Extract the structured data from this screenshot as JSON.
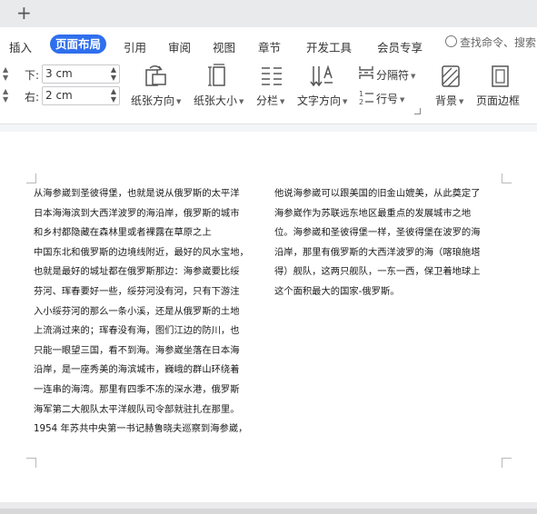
{
  "tabbar": {
    "new_tab": "+"
  },
  "menu": {
    "items": [
      "插入",
      "页面布局",
      "引用",
      "审阅",
      "视图",
      "章节",
      "开发工具",
      "会员专享"
    ],
    "active": "页面布局",
    "search_placeholder": "查找命令、搜索"
  },
  "ribbon": {
    "margin_bottom_label": "下:",
    "margin_bottom_value": "3 cm",
    "margin_right_label": "右:",
    "margin_right_value": "2 cm",
    "orientation": "纸张方向",
    "size": "纸张大小",
    "columns": "分栏",
    "text_direction": "文字方向",
    "breaks": "分隔符",
    "line_numbers": "行号",
    "background": "背景",
    "page_border": "页面边框"
  },
  "document": {
    "left_column": [
      "从海参崴到圣彼得堡，也就是说从俄罗斯的太平洋",
      "日本海海滨到大西洋波罗的海沿岸，俄罗斯的城市",
      "和乡村都隐藏在森林里或者裸露在草原之上",
      "中国东北和俄罗斯的边境线附近，最好的风水宝地，",
      "也就是最好的城址都在俄罗斯那边：海参崴要比绥",
      "芬河、珲春要好一些，绥芬河没有河，只有下游注",
      "入小绥芬河的那么一条小溪，还是从俄罗斯的土地",
      "上流淌过来的；珲春没有海，图们江边的防川，也",
      "只能一眼望三国，看不到海。海参崴坐落在日本海",
      "沿岸，是一座秀美的海滨城市，巍峨的群山环绕着",
      "一连串的海湾。那里有四季不冻的深水港，俄罗斯",
      "海军第二大舰队太平洋舰队司令部就驻扎在那里。",
      "1954 年苏共中央第一书记赫鲁晓夫巡察到海参崴，"
    ],
    "right_column": [
      "他说海参崴可以跟美国的旧金山媲美，从此奠定了",
      "海参崴作为苏联远东地区最重点的发展城市之地",
      "位。海参崴和圣彼得堡一样，圣彼得堡在波罗的海",
      "沿岸，那里有俄罗斯的大西洋波罗的海（喀琅施塔",
      "得）舰队，这两只舰队，一东一西，保卫着地球上",
      "这个面积最大的国家-俄罗斯。"
    ]
  }
}
